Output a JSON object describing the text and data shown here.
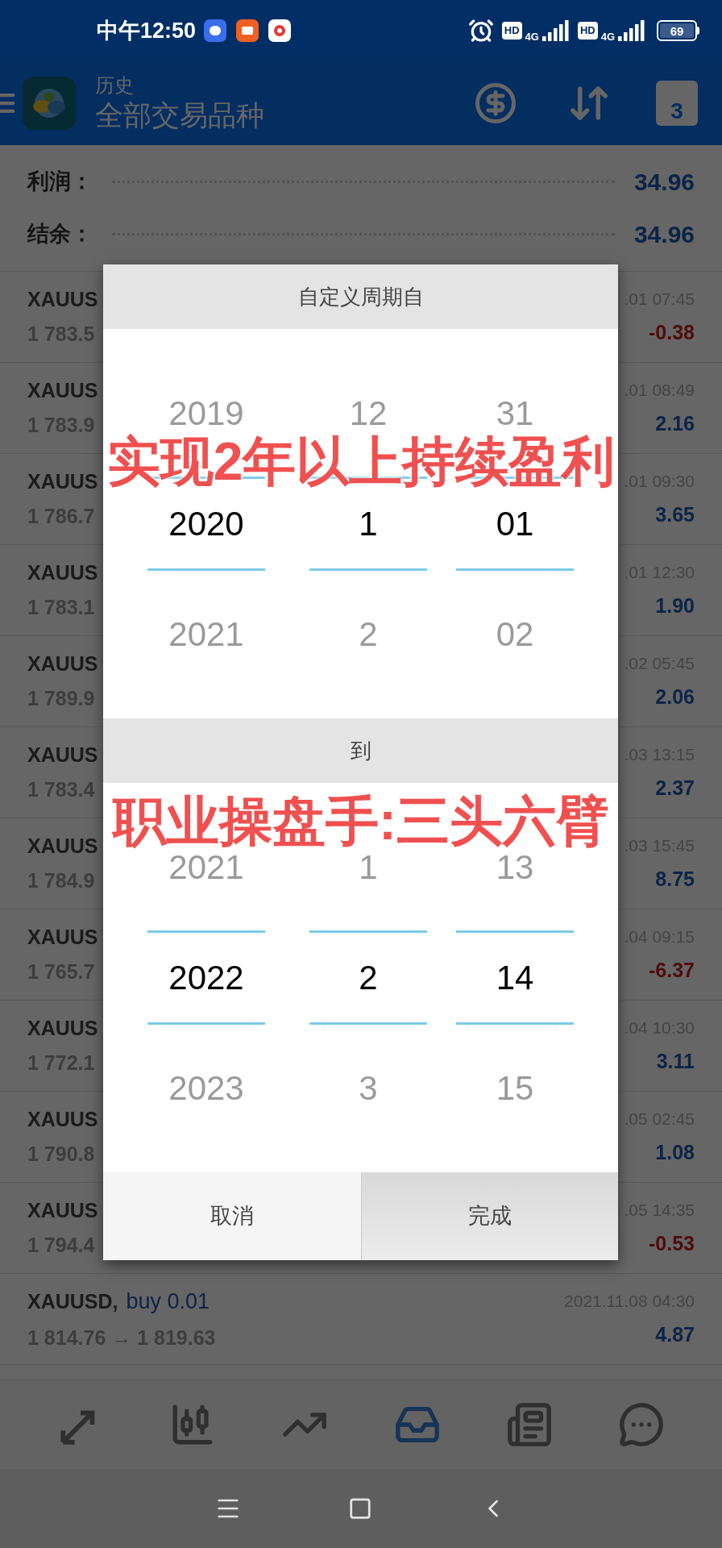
{
  "status_bar": {
    "time": "中午12:50",
    "network": [
      {
        "badge": "HD",
        "type": "4G"
      },
      {
        "badge": "HD",
        "type": "4G"
      }
    ],
    "battery": "69"
  },
  "app_bar": {
    "subtitle": "历史",
    "title": "全部交易品种",
    "calendar_day": "3"
  },
  "summary": [
    {
      "label": "利润：",
      "value": "34.96"
    },
    {
      "label": "结余：",
      "value": "34.96"
    }
  ],
  "trades": [
    {
      "symbol": "XAUUS",
      "price": "1 783.5",
      "time": ".01 07:45",
      "profit": "-0.38",
      "loss": true
    },
    {
      "symbol": "XAUUS",
      "price": "1 783.9",
      "time": ".01 08:49",
      "profit": "2.16",
      "loss": false
    },
    {
      "symbol": "XAUUS",
      "price": "1 786.7",
      "time": ".01 09:30",
      "profit": "3.65",
      "loss": false
    },
    {
      "symbol": "XAUUS",
      "price": "1 783.1",
      "time": ".01 12:30",
      "profit": "1.90",
      "loss": false
    },
    {
      "symbol": "XAUUS",
      "price": "1 789.9",
      "time": ".02 05:45",
      "profit": "2.06",
      "loss": false
    },
    {
      "symbol": "XAUUS",
      "price": "1 783.4",
      "time": ".03 13:15",
      "profit": "2.37",
      "loss": false
    },
    {
      "symbol": "XAUUS",
      "price": "1 784.9",
      "time": ".03 15:45",
      "profit": "8.75",
      "loss": false
    },
    {
      "symbol": "XAUUS",
      "price": "1 765.7",
      "time": ".04 09:15",
      "profit": "-6.37",
      "loss": true
    },
    {
      "symbol": "XAUUS",
      "price": "1 772.1",
      "time": ".04 10:30",
      "profit": "3.11",
      "loss": false
    },
    {
      "symbol": "XAUUS",
      "price": "1 790.8",
      "time": ".05 02:45",
      "profit": "1.08",
      "loss": false
    },
    {
      "symbol": "XAUUS",
      "price": "1 794.4",
      "time": ".05 14:35",
      "profit": "-0.53",
      "loss": true
    },
    {
      "symbol": "XAUUSD,",
      "order": "buy 0.01",
      "price": "1 814.76 → 1 819.63",
      "time": "2021.11.08 04:30",
      "profit": "4.87",
      "loss": false
    }
  ],
  "dialog": {
    "sections": [
      {
        "header": "自定义周期自",
        "columns": [
          {
            "items": [
              {
                "value": "2019",
                "selected": false
              },
              {
                "value": "2020",
                "selected": true
              },
              {
                "value": "2021",
                "selected": false
              }
            ]
          },
          {
            "items": [
              {
                "value": "12",
                "selected": false
              },
              {
                "value": "1",
                "selected": true
              },
              {
                "value": "2",
                "selected": false
              }
            ]
          },
          {
            "items": [
              {
                "value": "31",
                "selected": false
              },
              {
                "value": "01",
                "selected": true
              },
              {
                "value": "02",
                "selected": false
              }
            ]
          }
        ]
      },
      {
        "header": "到",
        "columns": [
          {
            "items": [
              {
                "value": "2021",
                "selected": false
              },
              {
                "value": "2022",
                "selected": true
              },
              {
                "value": "2023",
                "selected": false
              }
            ]
          },
          {
            "items": [
              {
                "value": "1",
                "selected": false
              },
              {
                "value": "2",
                "selected": true
              },
              {
                "value": "3",
                "selected": false
              }
            ]
          },
          {
            "items": [
              {
                "value": "13",
                "selected": false
              },
              {
                "value": "14",
                "selected": true
              },
              {
                "value": "15",
                "selected": false
              }
            ]
          }
        ]
      }
    ],
    "buttons": [
      {
        "label": "取消",
        "pressed": false
      },
      {
        "label": "完成",
        "pressed": true
      }
    ]
  },
  "overlay_captions": [
    "实现2年以上持续盈利",
    "职业操盘手:三头六臂"
  ],
  "bottom_nav": [
    {
      "kind": "trade",
      "selected": false
    },
    {
      "kind": "quotes",
      "selected": false
    },
    {
      "kind": "chart",
      "selected": false
    },
    {
      "kind": "history",
      "selected": true
    },
    {
      "kind": "news",
      "selected": false
    },
    {
      "kind": "chat",
      "selected": false
    }
  ]
}
